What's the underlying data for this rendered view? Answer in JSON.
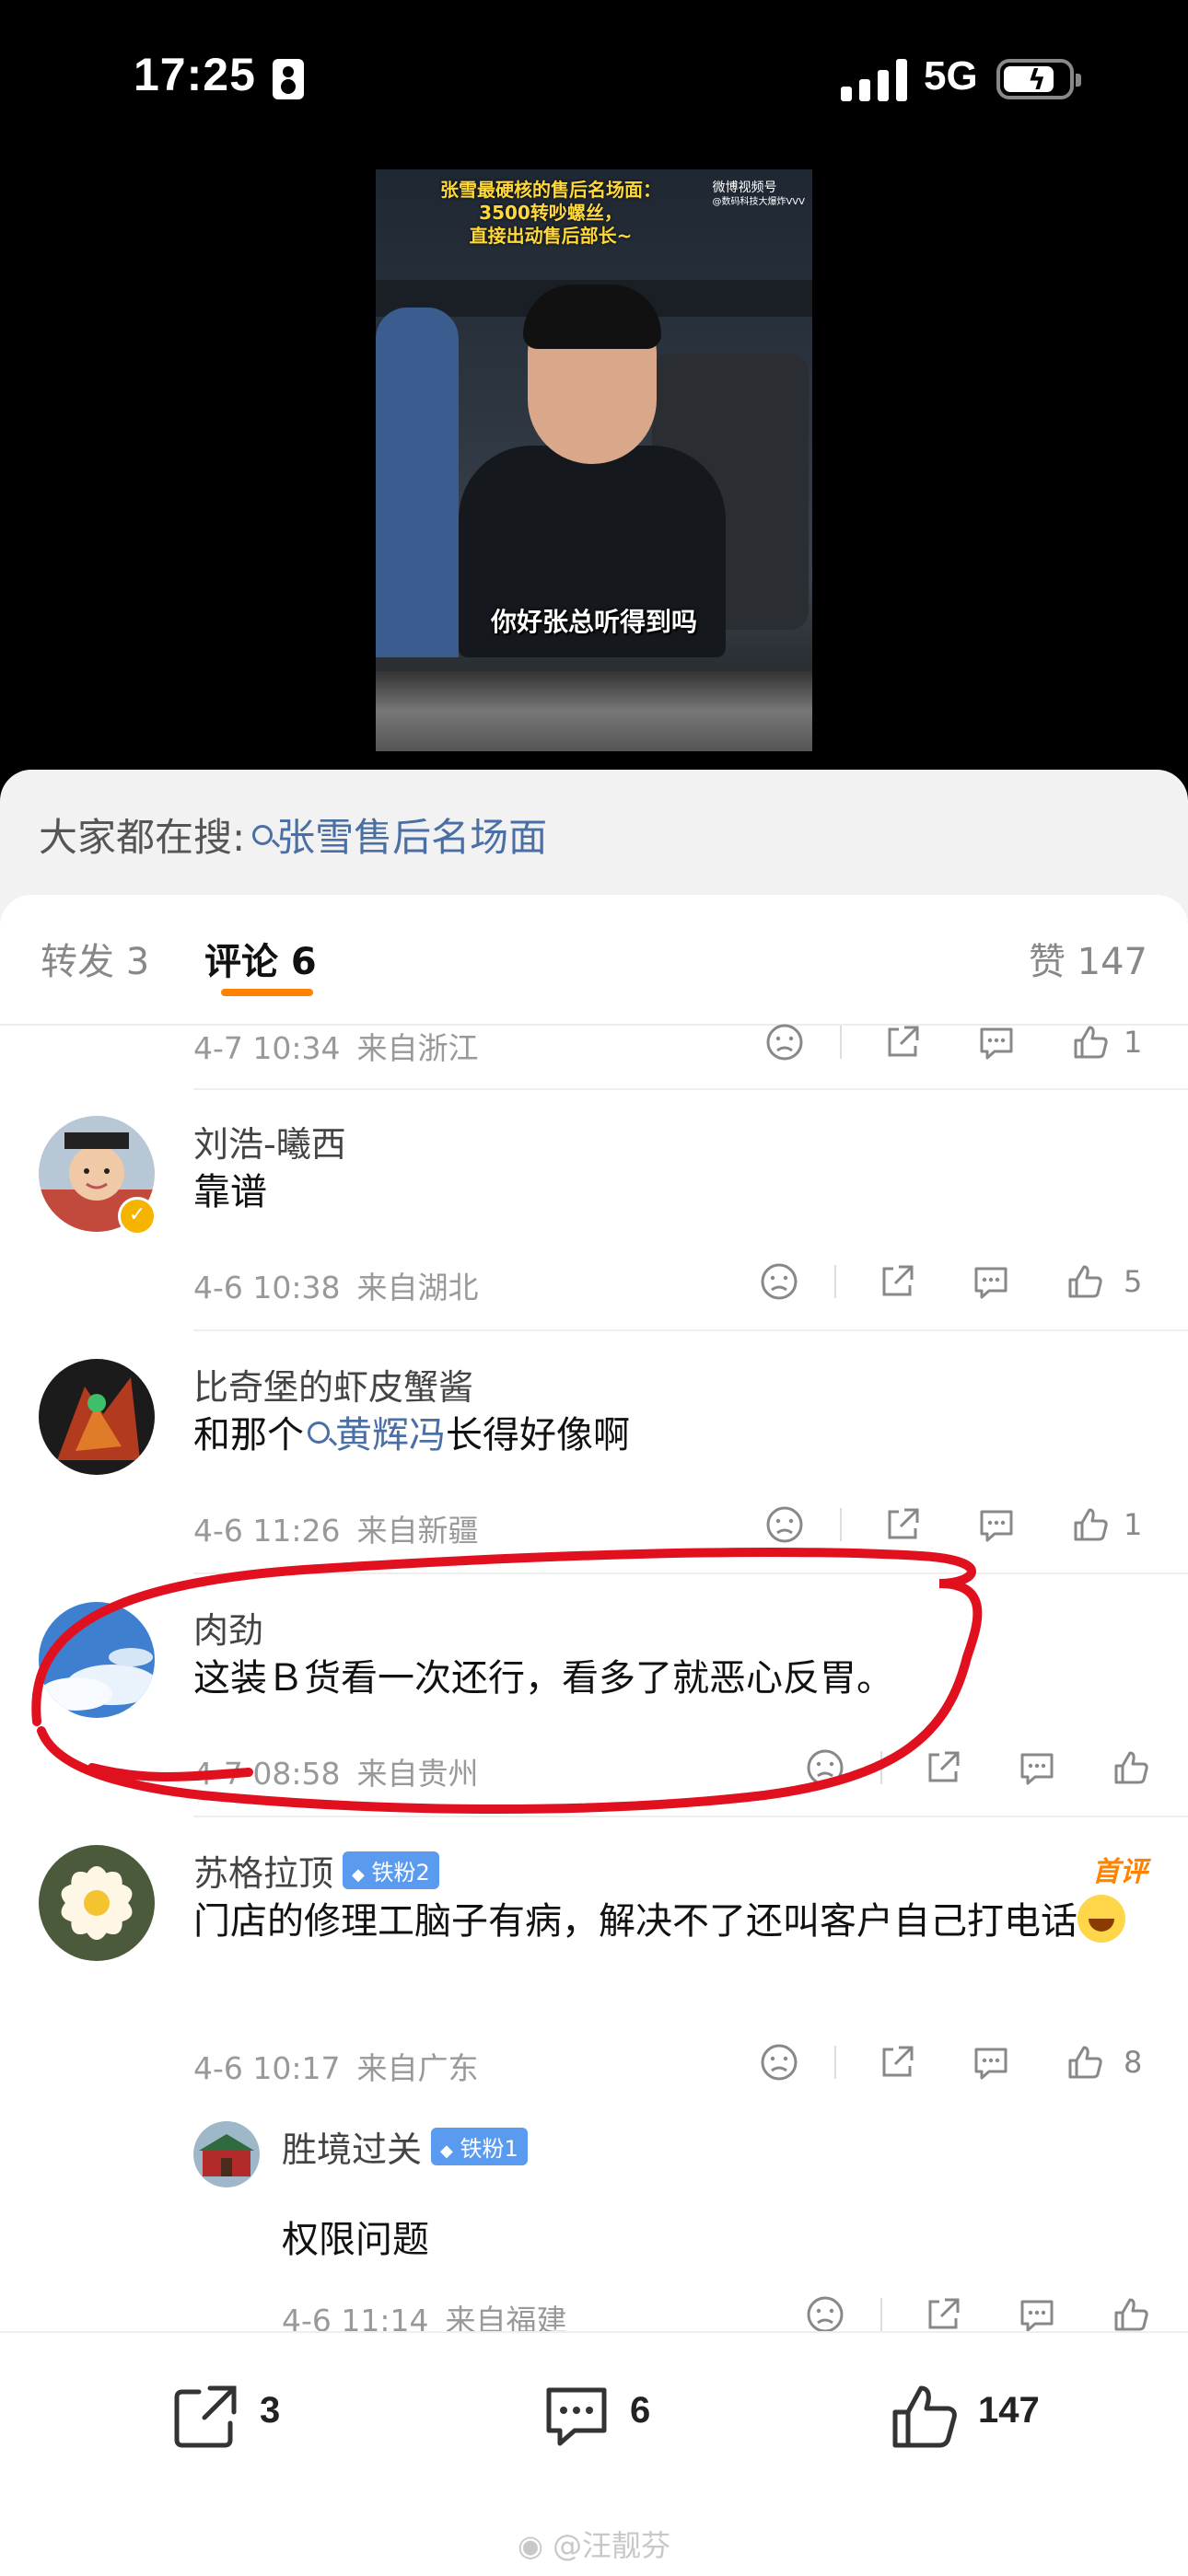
{
  "status_bar": {
    "time": "17:25",
    "network": "5G"
  },
  "video": {
    "caption_line1": "张雪最硬核的售后名场面：",
    "caption_line2": "3500转吵螺丝，",
    "caption_line3": "直接出动售后部长~",
    "watermark_line1": "微博视频号",
    "watermark_line2": "@数码科技大爆炸VVV",
    "subtitle": "你好张总听得到吗"
  },
  "search": {
    "label": "大家都在搜:",
    "query": "张雪售后名场面"
  },
  "tabs": {
    "repost": "转发 3",
    "comments": "评论 6",
    "likes": "赞 147"
  },
  "comments": [
    {
      "meta_time": "4-7 10:34",
      "meta_loc": "来自浙江",
      "likes": "1"
    },
    {
      "name": "刘浩-曦西",
      "text": "靠谱",
      "meta_time": "4-6 10:38",
      "meta_loc": "来自湖北",
      "likes": "5"
    },
    {
      "name": "比奇堡的虾皮蟹酱",
      "text_pre": "和那个",
      "text_link": "黄辉冯",
      "text_post": "长得好像啊",
      "meta_time": "4-6 11:26",
      "meta_loc": "来自新疆",
      "likes": "1"
    },
    {
      "name": "肉劲",
      "text": "这装Ｂ货看一次还行，看多了就恶心反胃。",
      "meta_time": "4-7 08:58",
      "meta_loc": "来自贵州",
      "likes": ""
    },
    {
      "name": "苏格拉顶",
      "badge": "铁粉2",
      "first_label": "首评",
      "text": "门店的修理工脑子有病，解决不了还叫客户自己打电话",
      "meta_time": "4-6 10:17",
      "meta_loc": "来自广东",
      "likes": "8"
    },
    {
      "name": "胜境过关",
      "badge": "铁粉1",
      "text": "权限问题",
      "meta_time": "4-6 11:14",
      "meta_loc": "来自福建",
      "likes": ""
    }
  ],
  "bottom_bar": {
    "repost_count": "3",
    "comment_count": "6",
    "like_count": "147"
  },
  "footer_watermark": "@汪靓芬",
  "colors": {
    "accent": "#ff8200",
    "link": "#4a6fa5",
    "marker": "#e0101e"
  }
}
